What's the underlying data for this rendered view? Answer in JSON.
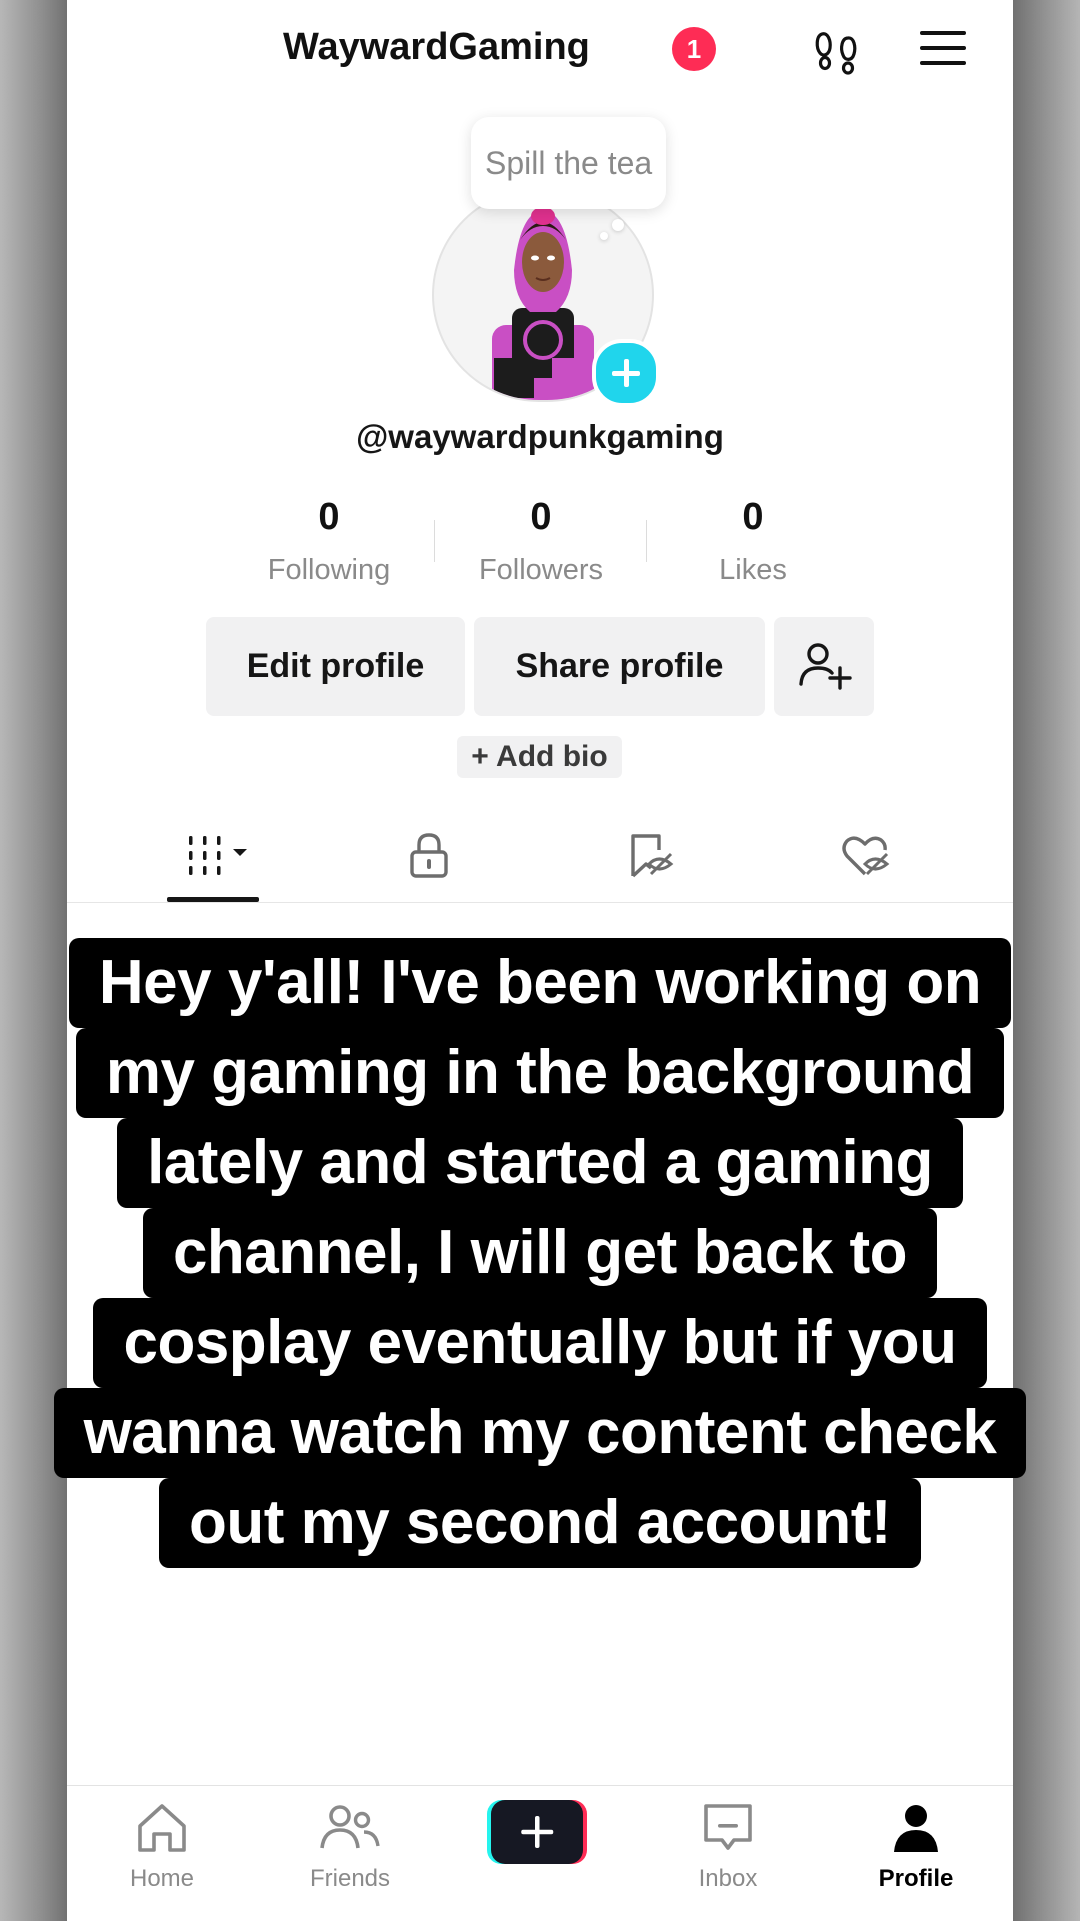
{
  "header": {
    "username": "WaywardGaming",
    "notification_count": "1"
  },
  "profile": {
    "status_bubble": "Spill the tea",
    "handle": "@waywardpunkgaming",
    "stats": [
      {
        "value": "0",
        "label": "Following"
      },
      {
        "value": "0",
        "label": "Followers"
      },
      {
        "value": "0",
        "label": "Likes"
      }
    ],
    "edit_button": "Edit profile",
    "share_button": "Share profile",
    "add_bio": "+ Add bio"
  },
  "tabs": [
    {
      "icon": "videos-grid-icon",
      "selected": true
    },
    {
      "icon": "lock-icon",
      "selected": false
    },
    {
      "icon": "hidden-favorites-icon",
      "selected": false
    },
    {
      "icon": "hidden-liked-icon",
      "selected": false
    }
  ],
  "caption_lines": [
    "Hey y'all! I've been working on",
    "my gaming in the background",
    "lately and started a gaming",
    "channel, I will get back to",
    "cosplay eventually but if you",
    "wanna watch my content check",
    "out my second account!"
  ],
  "nav": [
    {
      "label": "Home",
      "icon": "home-icon"
    },
    {
      "label": "Friends",
      "icon": "friends-icon"
    },
    {
      "label": "",
      "icon": "create-plus-icon"
    },
    {
      "label": "Inbox",
      "icon": "inbox-icon"
    },
    {
      "label": "Profile",
      "icon": "profile-icon",
      "active": true
    }
  ],
  "colors": {
    "accent": "#fe2c55",
    "cyan": "#20d5ec",
    "text": "#161616",
    "muted": "#8a8a8a"
  }
}
